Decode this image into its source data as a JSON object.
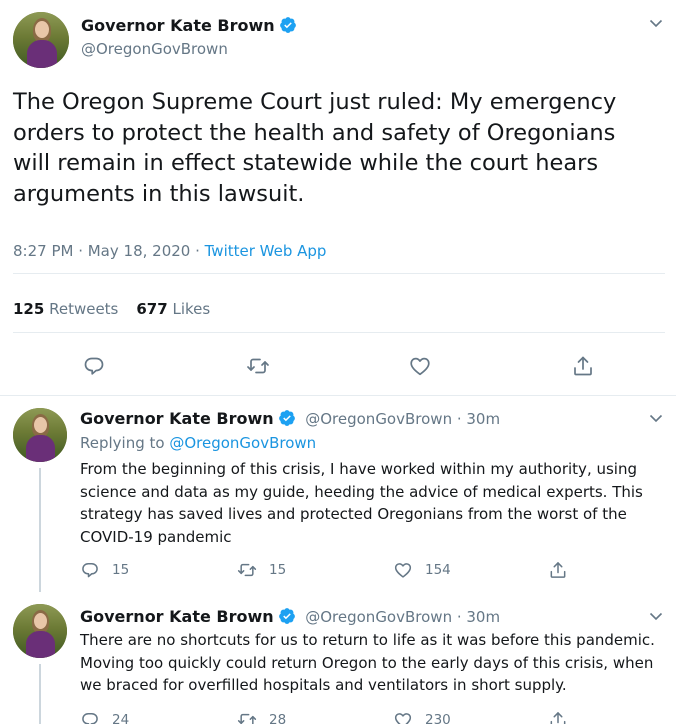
{
  "main_tweet": {
    "name": "Governor Kate Brown",
    "handle": "@OregonGovBrown",
    "text": "The Oregon Supreme Court just ruled: My emergency orders to protect the health and safety of Oregonians will remain in effect statewide while the court hears arguments in this lawsuit.",
    "time": "8:27 PM · May 18, 2020 · ",
    "source": "Twitter Web App",
    "retweets_count": "125",
    "retweets_label": "Retweets",
    "likes_count": "677",
    "likes_label": "Likes"
  },
  "replies": [
    {
      "name": "Governor Kate Brown",
      "handle_time": "@OregonGovBrown · 30m",
      "replying_prefix": "Replying to ",
      "replying_mention": "@OregonGovBrown",
      "text": "From the beginning of this crisis, I have worked within my authority, using science and data as my guide, heeding the advice of medical experts. This strategy has saved lives and protected Oregonians from the worst of the COVID-19 pandemic",
      "reply_count": "15",
      "retweet_count": "15",
      "like_count": "154"
    },
    {
      "name": "Governor Kate Brown",
      "handle_time": "@OregonGovBrown · 30m",
      "text": "There are no shortcuts for us to return to life as it was before this pandemic. Moving too quickly could return Oregon to the early days of this crisis, when we braced for overfilled hospitals and ventilators in short supply.",
      "reply_count": "24",
      "retweet_count": "28",
      "like_count": "230"
    }
  ],
  "colors": {
    "text": "#14171a",
    "secondary": "#657786",
    "link": "#1b95e0",
    "verified": "#1da1f2"
  }
}
